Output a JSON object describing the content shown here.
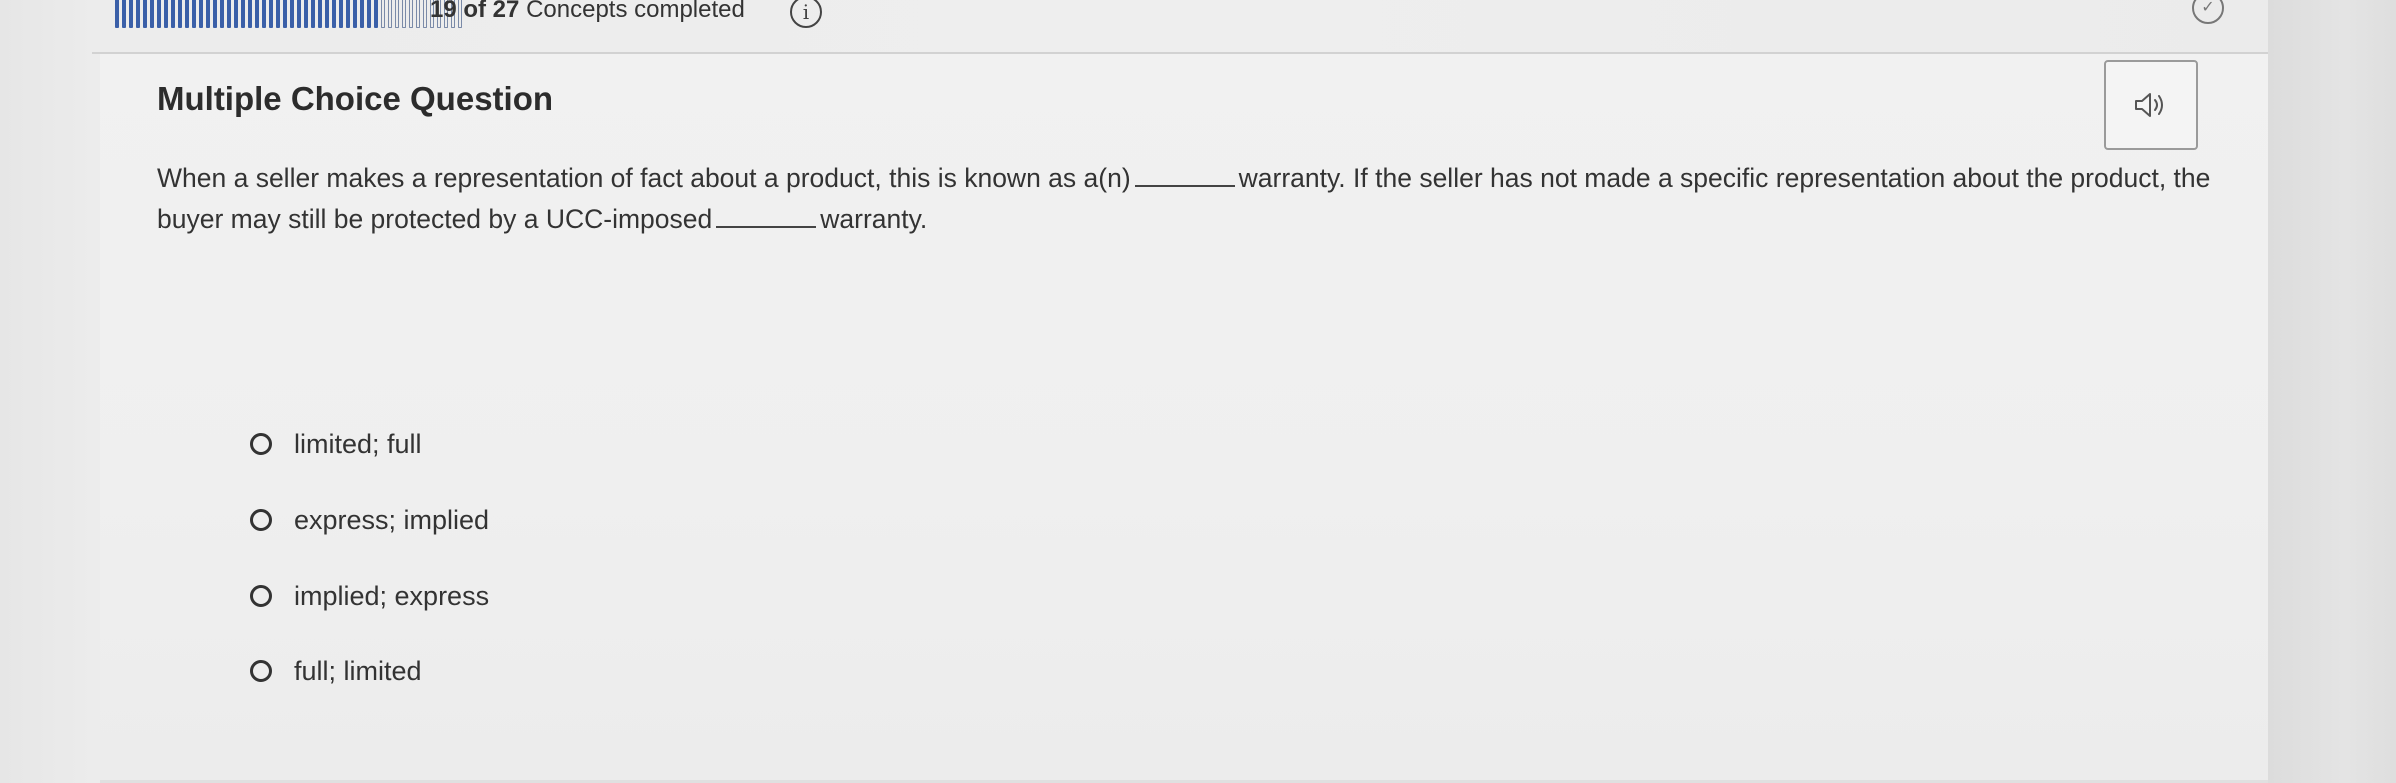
{
  "progress": {
    "completed": 19,
    "total": 27,
    "count_text": "19 of 27",
    "suffix_text": "Concepts completed",
    "info_icon": "info-icon",
    "status_icon": "check-circle-icon"
  },
  "question": {
    "heading": "Multiple Choice Question",
    "audio_icon": "speaker-icon",
    "text_part1": "When a seller makes a representation of fact about a product, this is known as a(n)",
    "text_part2": "warranty. If the seller has not made a specific representation about the product, the buyer may still be protected by a UCC-imposed",
    "text_part3": "warranty."
  },
  "options": [
    {
      "label": "limited; full"
    },
    {
      "label": "express; implied"
    },
    {
      "label": "implied; express"
    },
    {
      "label": "full; limited"
    }
  ],
  "colors": {
    "progress_fill": "#3a5fa8",
    "text": "#333333"
  }
}
